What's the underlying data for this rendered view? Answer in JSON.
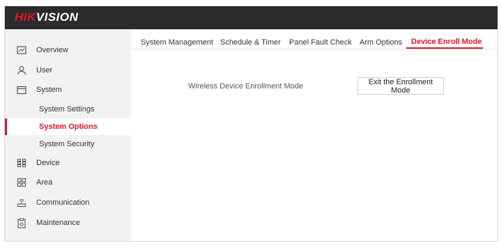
{
  "brand": {
    "logo_red": "HIK",
    "logo_white": "VISION",
    "accent": "#d7182a",
    "topbar_color": "#2b2b2b"
  },
  "sidebar": {
    "items": [
      {
        "label": "Overview",
        "icon": "overview-icon"
      },
      {
        "label": "User",
        "icon": "user-icon"
      },
      {
        "label": "System",
        "icon": "system-icon"
      },
      {
        "label": "Device",
        "icon": "device-icon"
      },
      {
        "label": "Area",
        "icon": "area-icon"
      },
      {
        "label": "Communication",
        "icon": "communication-icon"
      },
      {
        "label": "Maintenance",
        "icon": "maintenance-icon"
      }
    ],
    "system_sub": [
      {
        "label": "System Settings"
      },
      {
        "label": "System Options",
        "active": true
      },
      {
        "label": "System Security"
      }
    ]
  },
  "tabs": [
    {
      "label": "System Management"
    },
    {
      "label": "Schedule & Timer"
    },
    {
      "label": "Panel Fault Check"
    },
    {
      "label": "Arm Options"
    },
    {
      "label": "Device Enroll Mode",
      "active": true
    }
  ],
  "main": {
    "enroll_label": "Wireless Device Enrollment Mode",
    "exit_button": "Exit the Enrollment Mode"
  }
}
